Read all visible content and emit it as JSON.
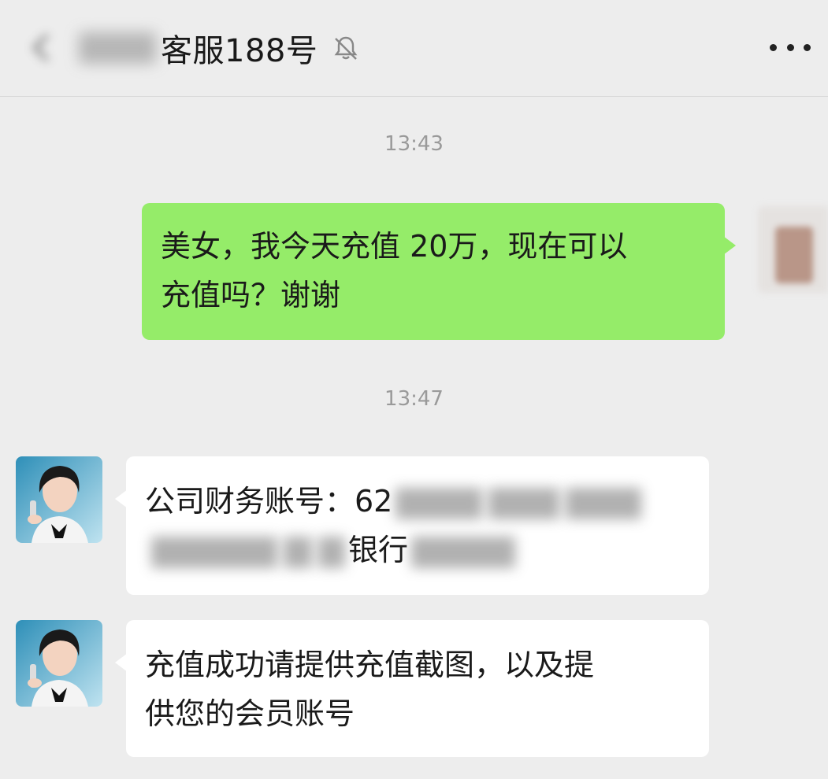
{
  "header": {
    "title": "客服188号",
    "back_icon": "back-arrow-icon",
    "mute_icon": "muted-bell-icon",
    "more_icon": "more-dots-icon"
  },
  "messages": [
    {
      "type": "time",
      "text": "13:43"
    },
    {
      "type": "sent",
      "text_line1": "美女，我今天充值 20万，现在可以",
      "text_line2": "充值吗？谢谢"
    },
    {
      "type": "time",
      "text": "13:47"
    },
    {
      "type": "received",
      "text_line1_prefix": "公司财务账号：62",
      "text_line2_bank": "银行"
    },
    {
      "type": "received",
      "text_line1": "充值成功请提供充值截图，以及提",
      "text_line2": "供您的会员账号"
    }
  ],
  "colors": {
    "background": "#ededed",
    "sent_bubble": "#95ec69",
    "received_bubble": "#ffffff",
    "timestamp": "#9a9a9a"
  }
}
